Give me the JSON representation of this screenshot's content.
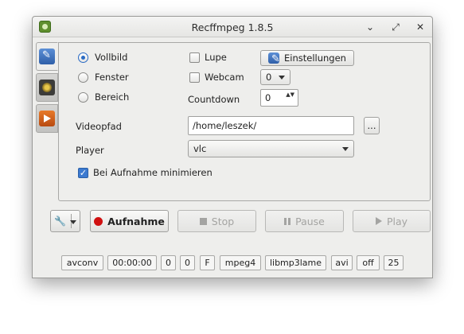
{
  "window": {
    "title": "Recffmpeg 1.8.5"
  },
  "icons": {
    "app": "recffmpeg-app-icon",
    "tabs": [
      "tools-icon",
      "audio-speaker-icon",
      "video-film-icon"
    ],
    "settings": "tools-icon",
    "minimize": "chevron-down-icon",
    "maximize": "maximize-icon",
    "close": "close-icon"
  },
  "glyphs": {
    "minimize": "⌄",
    "maximize": "⤢",
    "close": "✕",
    "check": "✓",
    "spin": "▲▼",
    "tools": "🔧"
  },
  "capture": {
    "options": [
      {
        "label": "Vollbild",
        "selected": true
      },
      {
        "label": "Fenster",
        "selected": false
      },
      {
        "label": "Bereich",
        "selected": false
      }
    ]
  },
  "lupe": {
    "label": "Lupe",
    "checked": false
  },
  "webcam": {
    "label": "Webcam",
    "checked": false,
    "value": "0"
  },
  "settings_button": {
    "label": "Einstellungen"
  },
  "countdown": {
    "label": "Countdown",
    "value": "0"
  },
  "videopfad": {
    "label": "Videopfad",
    "value": "/home/leszek/",
    "browse_label": "..."
  },
  "player": {
    "label": "Player",
    "value": "vlc"
  },
  "minimize_on_record": {
    "label": "Bei Aufnahme minimieren",
    "checked": true
  },
  "buttons": {
    "record": "Aufnahme",
    "stop": "Stop",
    "pause": "Pause",
    "play": "Play"
  },
  "status": [
    "avconv",
    "00:00:00",
    "0",
    "0",
    "F",
    "mpeg4",
    "libmp3lame",
    "avi",
    "off",
    "25"
  ],
  "colors": {
    "accent": "#2a6bc4",
    "record": "#d01010",
    "window_bg": "#eeeeec"
  }
}
